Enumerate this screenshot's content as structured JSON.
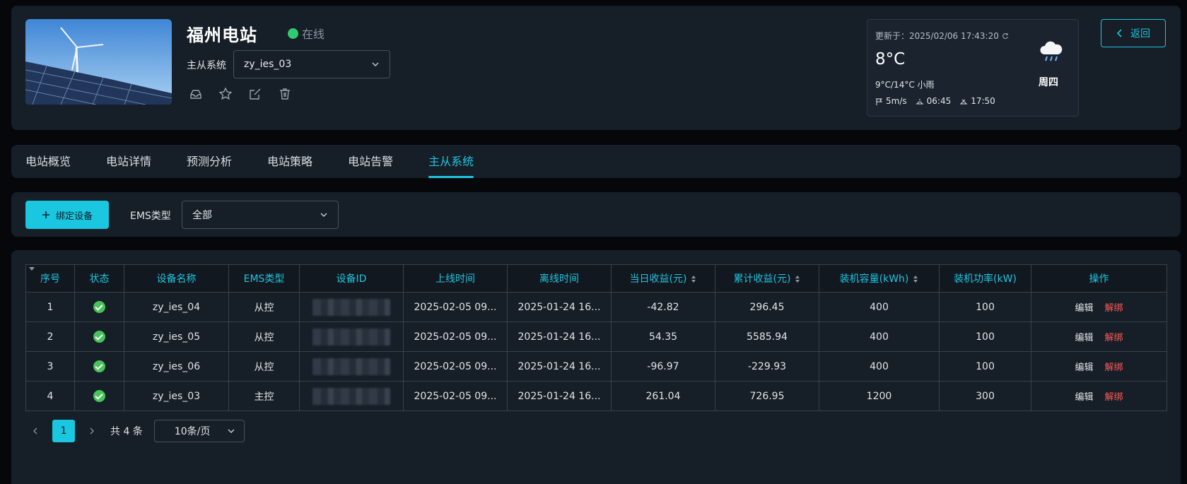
{
  "header": {
    "station_name": "福州电站",
    "status": "在线",
    "system_label": "主从系统",
    "system_value": "zy_ies_03",
    "weather": {
      "updated": "更新于：2025/02/06 17:43:20",
      "temp": "8°C",
      "range": "9°C/14°C 小雨",
      "wind": "5m/s",
      "sunrise": "06:45",
      "sunset": "17:50",
      "day": "周四"
    },
    "back_label": "返回"
  },
  "tabs": [
    "电站概览",
    "电站详情",
    "预测分析",
    "电站策略",
    "电站告警",
    "主从系统"
  ],
  "active_tab_index": 5,
  "filter": {
    "bind_label": "绑定设备",
    "ems_label": "EMS类型",
    "ems_value": "全部"
  },
  "table": {
    "columns": [
      "序号",
      "状态",
      "设备名称",
      "EMS类型",
      "设备ID",
      "上线时间",
      "离线时间",
      "当日收益(元)",
      "累计收益(元)",
      "装机容量(kWh)",
      "装机功率(kW)",
      "操作"
    ],
    "rows": [
      {
        "no": "1",
        "name": "zy_ies_04",
        "ems": "从控",
        "online": "2025-02-05 09...",
        "offline": "2025-01-24 16...",
        "day_income": "-42.82",
        "total_income": "296.45",
        "capacity": "400",
        "power": "100"
      },
      {
        "no": "2",
        "name": "zy_ies_05",
        "ems": "从控",
        "online": "2025-02-05 09...",
        "offline": "2025-01-24 16...",
        "day_income": "54.35",
        "total_income": "5585.94",
        "capacity": "400",
        "power": "100"
      },
      {
        "no": "3",
        "name": "zy_ies_06",
        "ems": "从控",
        "online": "2025-02-05 09...",
        "offline": "2025-01-24 16...",
        "day_income": "-96.97",
        "total_income": "-229.93",
        "capacity": "400",
        "power": "100"
      },
      {
        "no": "4",
        "name": "zy_ies_03",
        "ems": "主控",
        "online": "2025-02-05 09...",
        "offline": "2025-01-24 16...",
        "day_income": "261.04",
        "total_income": "726.95",
        "capacity": "1200",
        "power": "300"
      }
    ],
    "edit_label": "编辑",
    "unbind_label": "解绑"
  },
  "pagination": {
    "current": "1",
    "total": "共 4 条",
    "page_size": "10条/页"
  },
  "colors": {
    "accent": "#20c5e0",
    "online": "#2ecc71",
    "danger": "#ff5a5a"
  }
}
